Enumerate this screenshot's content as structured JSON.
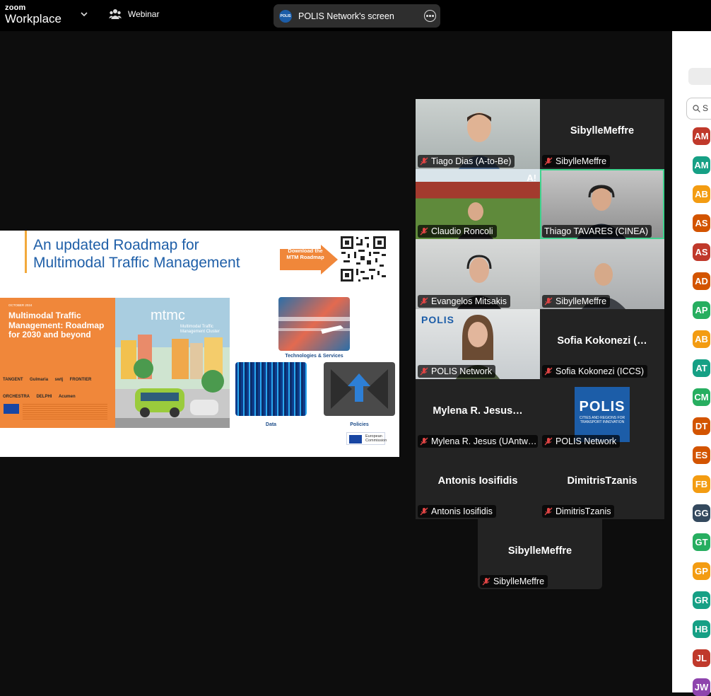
{
  "app": {
    "brand_small": "zoom",
    "brand_big": "Workplace",
    "mode_label": "Webinar"
  },
  "share": {
    "label": "POLIS Network's screen",
    "logo_text": "POLIS"
  },
  "slide": {
    "title_line1": "An updated Roadmap for",
    "title_line2": "Multimodal Traffic Management",
    "download_text": "Download the MTM Roadmap",
    "cover_date": "OCTOBER 2024",
    "cover_title": "Multimodal Traffic Management: Roadmap for 2030 and beyond",
    "partner_logos": [
      "TANGENT",
      "Gulmaria",
      "swtj",
      "FRONTIER",
      "ORCHESTRA",
      "DELPHI",
      "Acumen"
    ],
    "mtmc": "mtmc",
    "mtmc_sub": "Multimodal Traffic Management Cluster",
    "tile_tech": "Technologies & Services",
    "tile_data": "Data",
    "tile_policies": "Policies",
    "eu_text": "European Commission"
  },
  "participants": [
    {
      "center_name": "",
      "label": "Tiago Dias (A-to-Be)",
      "camera": true
    },
    {
      "center_name": "SibylleMeffre",
      "label": "SibylleMeffre",
      "camera": false
    },
    {
      "center_name": "",
      "label": "Claudio Roncoli",
      "camera": true,
      "badge": "A!"
    },
    {
      "center_name": "",
      "label": "Thiago TAVARES (CINEA)",
      "camera": true
    },
    {
      "center_name": "",
      "label": "Evangelos Mitsakis",
      "camera": true
    },
    {
      "center_name": "",
      "label": "SibylleMeffre",
      "camera": true
    },
    {
      "center_name": "",
      "label": "POLIS Network",
      "camera": true,
      "logo": "POLIS"
    },
    {
      "center_name": "Sofia Kokonezi (…",
      "label": "Sofia Kokonezi (ICCS)",
      "camera": false
    },
    {
      "center_name": "Mylena R. Jesus…",
      "label": "Mylena R. Jesus (UAntw…",
      "camera": false
    },
    {
      "center_name": "",
      "label": "POLIS Network",
      "camera": false,
      "logo": "POLIS",
      "logo_sub": "CITIES AND REGIONS FOR TRANSPORT INNOVATION"
    },
    {
      "center_name": "Antonis Iosifidis",
      "label": "Antonis Iosifidis",
      "camera": false
    },
    {
      "center_name": "DimitrisTzanis",
      "label": "DimitrisTzanis",
      "camera": false
    },
    {
      "center_name": "SibylleMeffre",
      "label": "SibylleMeffre",
      "camera": false
    }
  ],
  "panel": {
    "search_placeholder": "S",
    "avatars": [
      {
        "initials": "AM",
        "color": "#c0392b"
      },
      {
        "initials": "AM",
        "color": "#16a085"
      },
      {
        "initials": "AB",
        "color": "#f39c12"
      },
      {
        "initials": "AS",
        "color": "#d35400"
      },
      {
        "initials": "AS",
        "color": "#c0392b"
      },
      {
        "initials": "AD",
        "color": "#d35400"
      },
      {
        "initials": "AP",
        "color": "#27ae60"
      },
      {
        "initials": "AB",
        "color": "#f39c12"
      },
      {
        "initials": "AT",
        "color": "#16a085"
      },
      {
        "initials": "CM",
        "color": "#27ae60"
      },
      {
        "initials": "DT",
        "color": "#d35400"
      },
      {
        "initials": "ES",
        "color": "#d35400"
      },
      {
        "initials": "FB",
        "color": "#f39c12"
      },
      {
        "initials": "GG",
        "color": "#34495e"
      },
      {
        "initials": "GT",
        "color": "#27ae60"
      },
      {
        "initials": "GP",
        "color": "#f39c12"
      },
      {
        "initials": "GR",
        "color": "#16a085"
      },
      {
        "initials": "HB",
        "color": "#16a085"
      },
      {
        "initials": "JL",
        "color": "#c0392b"
      },
      {
        "initials": "JW",
        "color": "#8e44ad"
      }
    ]
  }
}
